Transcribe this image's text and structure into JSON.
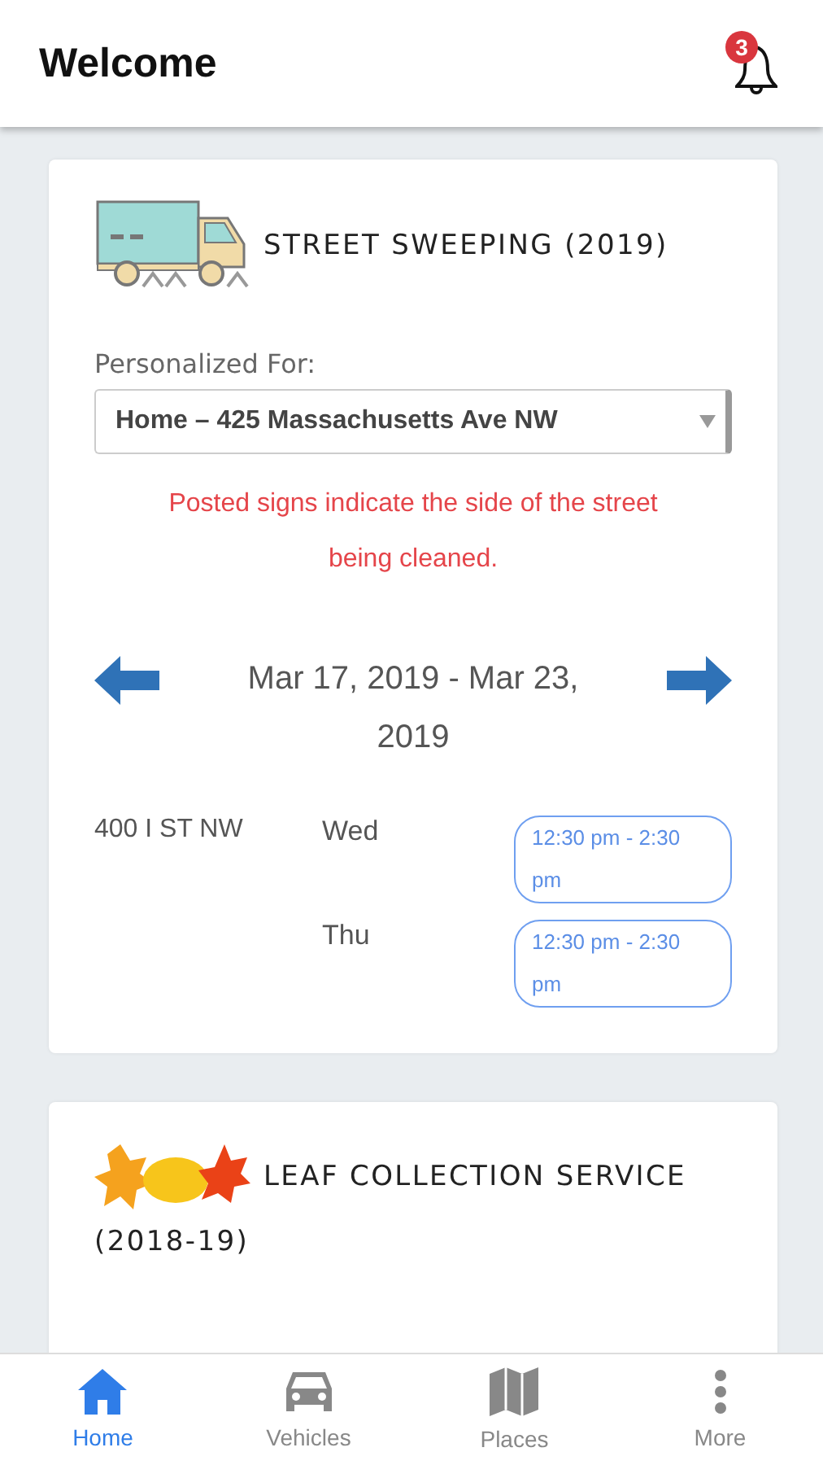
{
  "header": {
    "title": "Welcome",
    "notification_count": "3"
  },
  "cards": [
    {
      "kind": "sweeping",
      "title": "STREET SWEEPING (2019)",
      "personalized_label": "Personalized For:",
      "location": "Home – 425 Massachusetts Ave NW",
      "notice": "Posted signs indicate the side of the street being cleaned.",
      "date_range": "Mar 17, 2019 - Mar 23, 2019",
      "schedule": [
        {
          "street": "400 I ST NW",
          "days": [
            {
              "day": "Wed",
              "time": "12:30 pm - 2:30 pm"
            },
            {
              "day": "Thu",
              "time": "12:30 pm - 2:30 pm"
            }
          ]
        }
      ]
    },
    {
      "kind": "leaf",
      "title": "LEAF COLLECTION SERVICE",
      "subtitle": "(2018-19)"
    }
  ],
  "nav": [
    {
      "label": "Home",
      "kind": "home",
      "selected": true
    },
    {
      "label": "Vehicles",
      "kind": "car",
      "selected": false
    },
    {
      "label": "Places",
      "kind": "map",
      "selected": false
    },
    {
      "label": "More",
      "kind": "more",
      "selected": false
    }
  ]
}
